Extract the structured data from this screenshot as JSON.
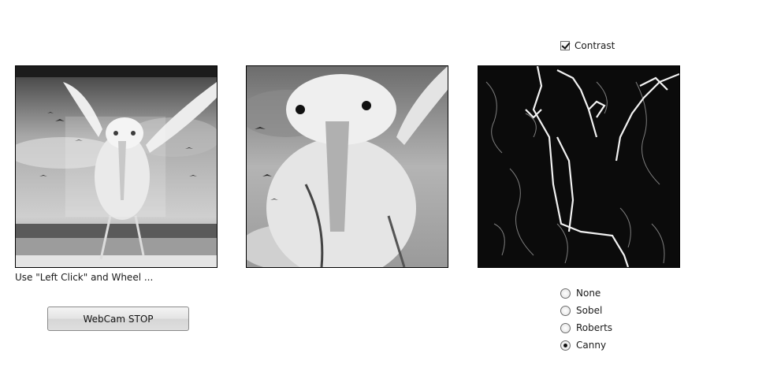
{
  "options": {
    "contrast_label": "Contrast",
    "contrast_checked": true
  },
  "hint": {
    "text": "Use \"Left Click\" and Wheel ..."
  },
  "controls": {
    "webcam_button_label": "WebCam STOP"
  },
  "filters": {
    "selected": "Canny",
    "items": [
      {
        "label": "None"
      },
      {
        "label": "Sobel"
      },
      {
        "label": "Roberts"
      },
      {
        "label": "Canny"
      }
    ]
  }
}
